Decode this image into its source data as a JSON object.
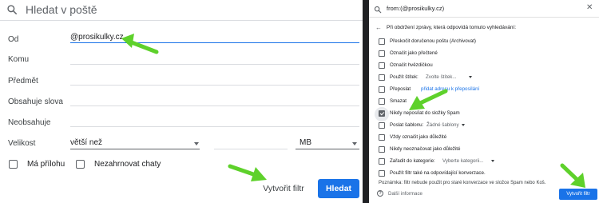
{
  "left": {
    "search_placeholder": "Hledat v poště",
    "fields": [
      {
        "label": "Od",
        "value": "@prosikulky.cz"
      },
      {
        "label": "Komu",
        "value": ""
      },
      {
        "label": "Předmět",
        "value": ""
      },
      {
        "label": "Obsahuje slova",
        "value": ""
      },
      {
        "label": "Neobsahuje",
        "value": ""
      }
    ],
    "size": {
      "label": "Velikost",
      "operator": "větší než",
      "value": "",
      "unit": "MB"
    },
    "checkboxes": {
      "has_attachment": "Má přílohu",
      "no_chats": "Nezahrnovat chaty"
    },
    "buttons": {
      "create_filter": "Vytvořit filtr",
      "search": "Hledat"
    }
  },
  "right": {
    "query": "from:(@prosikulky.cz)",
    "heading": "Při obdržení zprávy, která odpovídá tomuto vyhledávání:",
    "options": {
      "skip_inbox": "Přeskočit doručenou poštu (Archivovat)",
      "mark_read": "Označit jako přečtené",
      "star": "Označit hvězdičkou",
      "apply_label": "Použít štítek:",
      "apply_label_select": "Zvolte štítek...",
      "forward": "Přeposlat",
      "forward_link": "přidat adresu k přeposílání",
      "delete": "Smazat",
      "never_spam": "Nikdy neposílat do složky Spam",
      "send_template": "Poslat šablonu:",
      "send_template_select": "Žádné šablony",
      "always_important": "Vždy označit jako důležité",
      "never_important": "Nikdy neoznačovat jako důležité",
      "categorize": "Zařadit do kategorie:",
      "categorize_select": "Vyberte kategorii...",
      "also_apply": "Použít filtr také na odpovídající konverzace."
    },
    "note": "Poznámka: filtr nebude použit pro staré konverzace ve složce Spam nebo Koš.",
    "more_info": "Další informace",
    "create_button": "Vytvořit filtr"
  },
  "colors": {
    "primary": "#1a73e8",
    "arrow": "#5ed12b",
    "divider": "#202124"
  }
}
